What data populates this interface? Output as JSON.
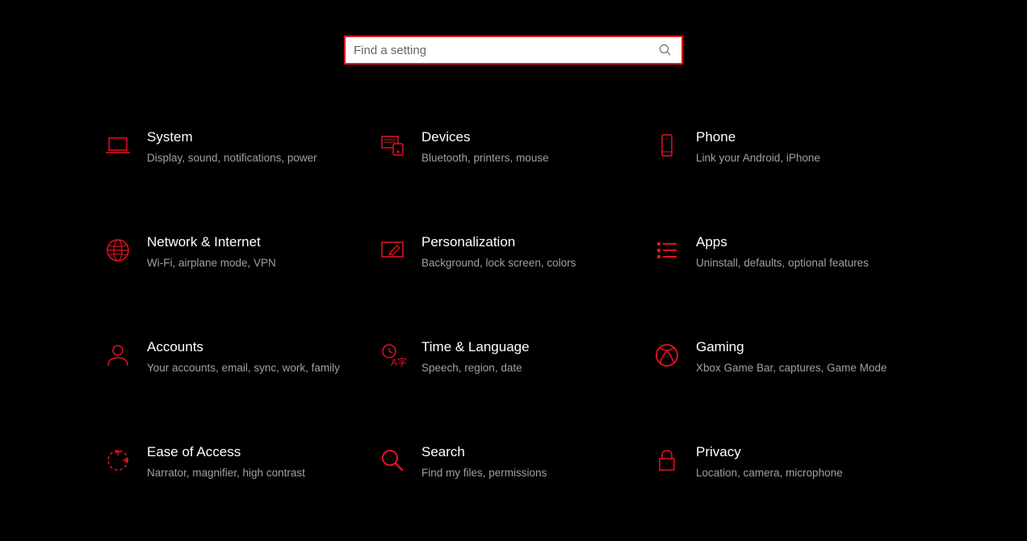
{
  "accent_color": "#e81123",
  "search": {
    "placeholder": "Find a setting"
  },
  "categories": [
    {
      "id": "system",
      "title": "System",
      "desc": "Display, sound, notifications, power",
      "icon": "laptop-icon"
    },
    {
      "id": "devices",
      "title": "Devices",
      "desc": "Bluetooth, printers, mouse",
      "icon": "devices-icon"
    },
    {
      "id": "phone",
      "title": "Phone",
      "desc": "Link your Android, iPhone",
      "icon": "phone-icon"
    },
    {
      "id": "network",
      "title": "Network & Internet",
      "desc": "Wi-Fi, airplane mode, VPN",
      "icon": "globe-icon"
    },
    {
      "id": "personalization",
      "title": "Personalization",
      "desc": "Background, lock screen, colors",
      "icon": "paintbrush-icon"
    },
    {
      "id": "apps",
      "title": "Apps",
      "desc": "Uninstall, defaults, optional features",
      "icon": "apps-list-icon"
    },
    {
      "id": "accounts",
      "title": "Accounts",
      "desc": "Your accounts, email, sync, work, family",
      "icon": "person-icon"
    },
    {
      "id": "time-language",
      "title": "Time & Language",
      "desc": "Speech, region, date",
      "icon": "time-language-icon"
    },
    {
      "id": "gaming",
      "title": "Gaming",
      "desc": "Xbox Game Bar, captures, Game Mode",
      "icon": "xbox-icon"
    },
    {
      "id": "ease-of-access",
      "title": "Ease of Access",
      "desc": "Narrator, magnifier, high contrast",
      "icon": "ease-of-access-icon"
    },
    {
      "id": "search",
      "title": "Search",
      "desc": "Find my files, permissions",
      "icon": "magnifier-icon"
    },
    {
      "id": "privacy",
      "title": "Privacy",
      "desc": "Location, camera, microphone",
      "icon": "lock-icon"
    }
  ]
}
